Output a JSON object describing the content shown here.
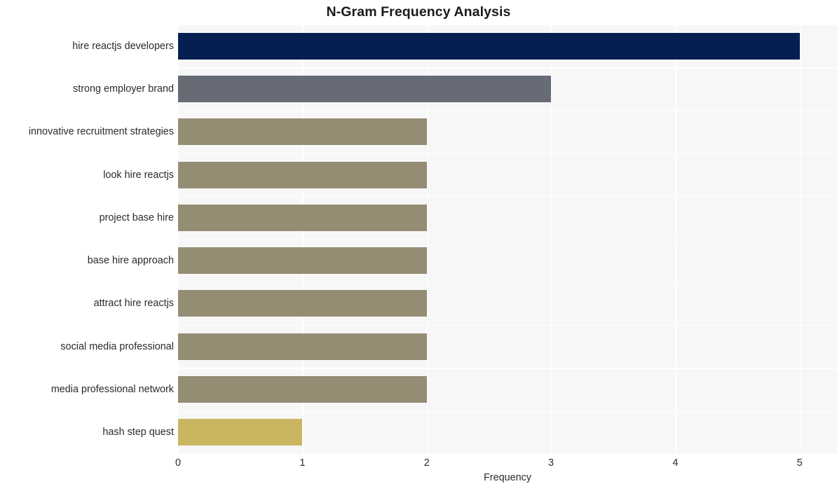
{
  "chart_data": {
    "type": "bar",
    "orientation": "horizontal",
    "title": "N-Gram Frequency Analysis",
    "xlabel": "Frequency",
    "ylabel": "",
    "categories": [
      "hire reactjs developers",
      "strong employer brand",
      "innovative recruitment strategies",
      "look hire reactjs",
      "project base hire",
      "base hire approach",
      "attract hire reactjs",
      "social media professional",
      "media professional network",
      "hash step quest"
    ],
    "values": [
      5,
      3,
      2,
      2,
      2,
      2,
      2,
      2,
      2,
      1
    ],
    "bar_colors": [
      "#052050",
      "#676b76",
      "#948d74",
      "#948d74",
      "#948d74",
      "#948d74",
      "#948d74",
      "#948d74",
      "#948d74",
      "#cab660"
    ],
    "xlim": [
      0,
      5.3
    ],
    "xticks": [
      0,
      1,
      2,
      3,
      4,
      5
    ],
    "xtick_labels": [
      "0",
      "1",
      "2",
      "3",
      "4",
      "5"
    ],
    "grid": true,
    "grid_color": "#ffffff",
    "legend": null,
    "plot_background": "#f7f7f8",
    "figure_background": "#ffffff",
    "title_color": "#1a1a1a",
    "tick_label_color": "#2b2b2b"
  }
}
